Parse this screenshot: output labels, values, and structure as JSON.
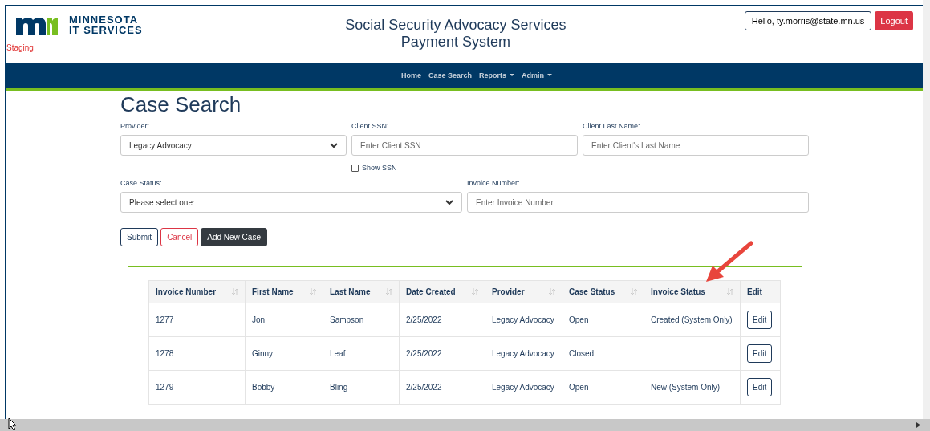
{
  "header": {
    "logo_line1": "MINNESOTA",
    "logo_line2": "IT SERVICES",
    "environment": "Staging",
    "title_line1": "Social Security Advocacy Services",
    "title_line2": "Payment System",
    "user_greeting": "Hello, ty.morris@state.mn.us",
    "logout": "Logout"
  },
  "nav": [
    {
      "label": "Home",
      "dropdown": false
    },
    {
      "label": "Case Search",
      "dropdown": false
    },
    {
      "label": "Reports",
      "dropdown": true
    },
    {
      "label": "Admin",
      "dropdown": true
    }
  ],
  "page_title": "Case Search",
  "form": {
    "provider": {
      "label": "Provider:",
      "value": "Legacy Advocacy"
    },
    "client_ssn": {
      "label": "Client SSN:",
      "placeholder": "Enter Client SSN"
    },
    "show_ssn": {
      "label": "Show SSN",
      "checked": false
    },
    "client_last_name": {
      "label": "Client Last Name:",
      "placeholder": "Enter Client's Last Name"
    },
    "case_status": {
      "label": "Case Status:",
      "value": "Please select one:"
    },
    "invoice_number": {
      "label": "Invoice Number:",
      "placeholder": "Enter Invoice Number"
    }
  },
  "buttons": [
    {
      "label": "Submit",
      "kind": "outline"
    },
    {
      "label": "Cancel",
      "kind": "danger"
    },
    {
      "label": "Add New Case",
      "kind": "dark"
    }
  ],
  "table": {
    "columns": [
      {
        "label": "Invoice Number",
        "sortable": true
      },
      {
        "label": "First Name",
        "sortable": true
      },
      {
        "label": "Last Name",
        "sortable": true
      },
      {
        "label": "Date Created",
        "sortable": true
      },
      {
        "label": "Provider",
        "sortable": true
      },
      {
        "label": "Case Status",
        "sortable": true
      },
      {
        "label": "Invoice Status",
        "sortable": true
      },
      {
        "label": "Edit",
        "sortable": false
      }
    ],
    "rows": [
      {
        "cells": [
          "1277",
          "Jon",
          "Sampson",
          "2/25/2022",
          "Legacy Advocacy",
          "Open",
          "Created (System Only)"
        ],
        "action": "Edit"
      },
      {
        "cells": [
          "1278",
          "Ginny",
          "Leaf",
          "2/25/2022",
          "Legacy Advocacy",
          "Closed",
          ""
        ],
        "action": "Edit"
      },
      {
        "cells": [
          "1279",
          "Bobby",
          "Bling",
          "2/25/2022",
          "Legacy Advocacy",
          "Open",
          "New (System Only)"
        ],
        "action": "Edit"
      }
    ]
  }
}
